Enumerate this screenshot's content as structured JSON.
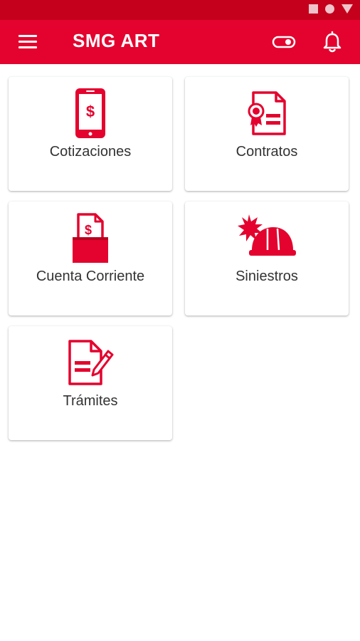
{
  "app_bar": {
    "title": "SMG ART",
    "menu_icon": "hamburger-menu-icon",
    "toggle_icon": "toggle-icon",
    "notification_icon": "bell-icon"
  },
  "status_bar": {
    "icons": [
      "square-icon",
      "circle-icon",
      "triangle-icon"
    ]
  },
  "colors": {
    "primary": "#e4032e",
    "status_bar": "#c4001c",
    "tile_text": "#333333"
  },
  "tiles": [
    {
      "label": "Cotizaciones",
      "icon": "phone-dollar-icon"
    },
    {
      "label": "Contratos",
      "icon": "certificate-document-icon"
    },
    {
      "label": "Cuenta Corriente",
      "icon": "dollar-folder-icon"
    },
    {
      "label": "Siniestros",
      "icon": "hard-hat-icon"
    },
    {
      "label": "Trámites",
      "icon": "document-pencil-icon"
    }
  ]
}
